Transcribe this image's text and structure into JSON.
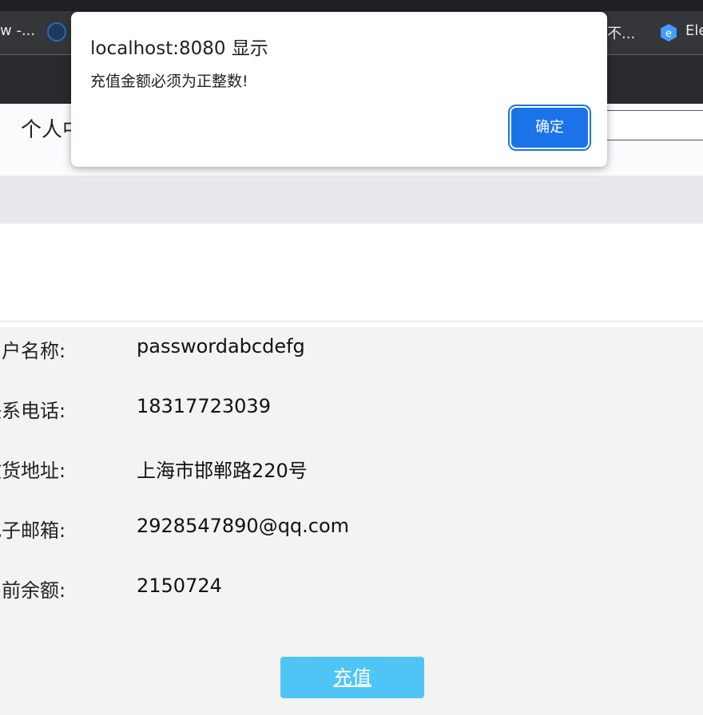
{
  "browser": {
    "bookmarks": [
      {
        "label": "w -..."
      },
      {
        "label": "不..."
      },
      {
        "label": "Ele"
      }
    ]
  },
  "page": {
    "title": "个人中心"
  },
  "info_rows": [
    {
      "label": "用户名称:",
      "value": "passwordabcdefg"
    },
    {
      "label": "联系电话:",
      "value": "18317723039"
    },
    {
      "label": "收货地址:",
      "value": "上海市邯郸路220号"
    },
    {
      "label": "电子邮箱:",
      "value": "2928547890@qq.com"
    },
    {
      "label": "当前余额:",
      "value": "2150724"
    }
  ],
  "recharge_button": "充值",
  "dialog": {
    "title": "localhost:8080 显示",
    "message": "充值金额必须为正整数!",
    "ok_label": "确定"
  },
  "colors": {
    "dialog_button": "#1a73e8",
    "recharge_button": "#4fc5f6"
  }
}
